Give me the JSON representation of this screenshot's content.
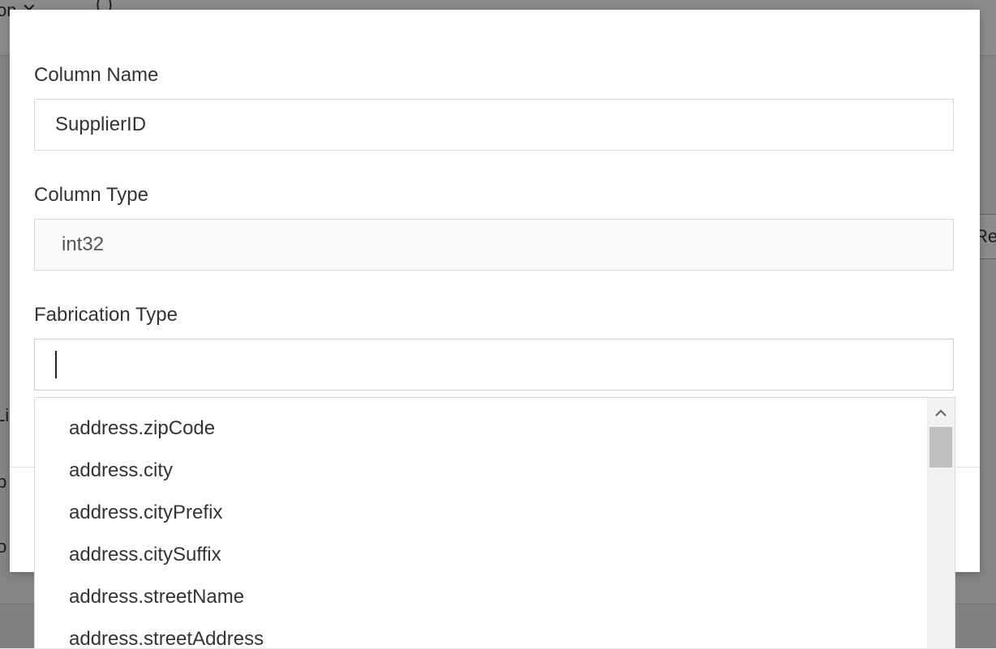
{
  "background": {
    "top_left_text": "on ✕",
    "top_bracket": "( )",
    "right_text": "Re",
    "left_text_1": "Li",
    "left_text_2": "p",
    "left_text_3": "o"
  },
  "form": {
    "column_name": {
      "label": "Column Name",
      "value": "SupplierID"
    },
    "column_type": {
      "label": "Column Type",
      "value": "int32"
    },
    "fabrication_type": {
      "label": "Fabrication Type",
      "value": ""
    }
  },
  "dropdown": {
    "options": [
      "address.zipCode",
      "address.city",
      "address.cityPrefix",
      "address.citySuffix",
      "address.streetName",
      "address.streetAddress"
    ],
    "scroll_up_icon": "chevron-up-icon"
  },
  "colors": {
    "accent": "#6b3fa0",
    "border": "#d9d9d9"
  }
}
